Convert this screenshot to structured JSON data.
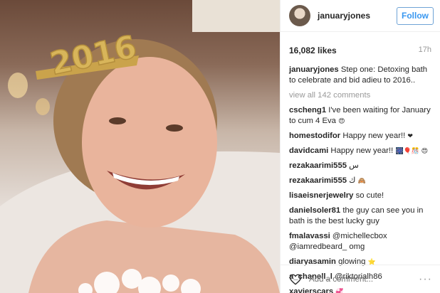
{
  "post": {
    "username": "januaryjones",
    "follow_label": "Follow",
    "likes": "16,082 likes",
    "time": "17h",
    "caption_user": "januaryjones",
    "caption_text": "Step one: Detoxing bath to celebrate and bid adieu to 2016..",
    "view_all": "view all 142 comments",
    "add_comment_placeholder": "Add a comment...",
    "more_label": "···",
    "crown_text": "2016"
  },
  "comments": [
    {
      "user": "cscheng1",
      "text": "I've been waiting for January to cum 4 Eva",
      "emoji": "😍"
    },
    {
      "user": "homestodifor",
      "text": "Happy new year!!",
      "emoji": "❤"
    },
    {
      "user": "davidcami",
      "text": "Happy new year!!",
      "emoji": "🎆🎈🎊 😍"
    },
    {
      "user": "rezakaarimi555",
      "text": "س",
      "emoji": ""
    },
    {
      "user": "rezakaarimi555",
      "text": "ك",
      "emoji": "🙈"
    },
    {
      "user": "lisaeisnerjewelry",
      "text": "so cute!",
      "emoji": ""
    },
    {
      "user": "danielsoler81",
      "text": "the guy can see you in bath is the best lucky guy",
      "emoji": ""
    },
    {
      "user": "fmalavassi",
      "text": "@michellecbox @iamredbeard_ omg",
      "emoji": ""
    },
    {
      "user": "diaryasamin",
      "text": "glowing",
      "emoji": "⭐"
    },
    {
      "user": "a_chanell_l",
      "text": "@riktorialh86",
      "emoji": ""
    },
    {
      "user": "xavierscars",
      "text": "",
      "emoji": "💞"
    }
  ],
  "colors": {
    "follow_blue": "#3897f0",
    "muted_gray": "#999999",
    "crown_gold": "#d8b55a"
  },
  "icons": {
    "like": "heart-icon",
    "more": "more-options-icon"
  }
}
